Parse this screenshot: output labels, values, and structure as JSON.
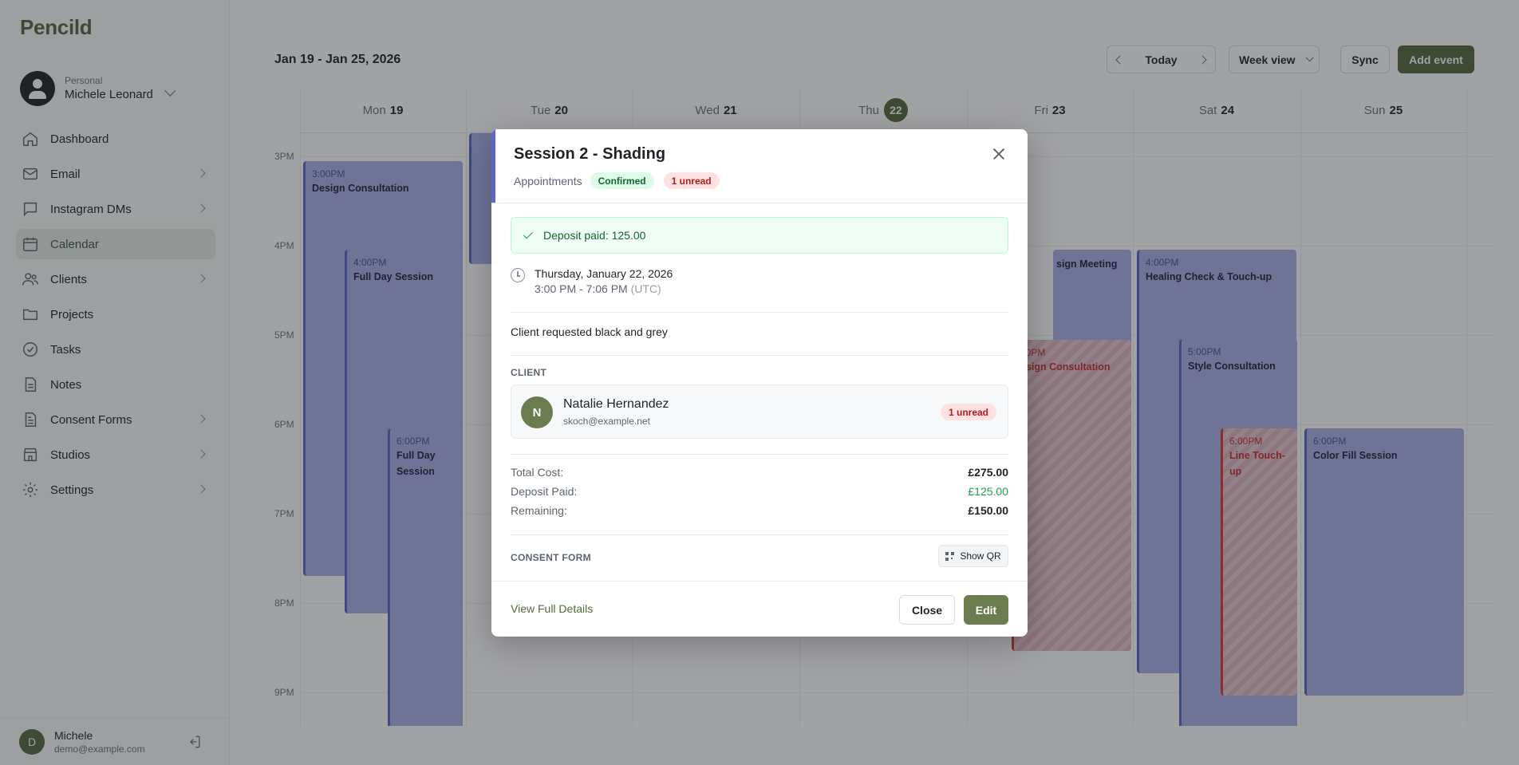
{
  "app": {
    "name": "Pencild"
  },
  "account": {
    "type": "Personal",
    "name": "Michele Leonard"
  },
  "nav": {
    "items": [
      {
        "label": "Dashboard"
      },
      {
        "label": "Email"
      },
      {
        "label": "Instagram DMs"
      },
      {
        "label": "Calendar"
      },
      {
        "label": "Clients"
      },
      {
        "label": "Projects"
      },
      {
        "label": "Tasks"
      },
      {
        "label": "Notes"
      },
      {
        "label": "Consent Forms"
      },
      {
        "label": "Studios"
      },
      {
        "label": "Settings"
      }
    ]
  },
  "user": {
    "initial": "D",
    "name": "Michele",
    "email": "demo@example.com"
  },
  "toolbar": {
    "range": "Jan 19 - Jan 25, 2026",
    "today_label": "Today",
    "view_label": "Week view",
    "sync_label": "Sync",
    "add_label": "Add event"
  },
  "calendar": {
    "days": [
      {
        "name": "Mon",
        "num": "19"
      },
      {
        "name": "Tue",
        "num": "20"
      },
      {
        "name": "Wed",
        "num": "21"
      },
      {
        "name": "Thu",
        "num": "22"
      },
      {
        "name": "Fri",
        "num": "23"
      },
      {
        "name": "Sat",
        "num": "24"
      },
      {
        "name": "Sun",
        "num": "25"
      }
    ],
    "hours": [
      "3PM",
      "4PM",
      "5PM",
      "6PM",
      "7PM",
      "8PM",
      "9PM"
    ],
    "events": [
      {
        "time": "3:00PM",
        "title": "Design Consultation"
      },
      {
        "time": "4:00PM",
        "title": "Full Day Session"
      },
      {
        "time": "6:00PM",
        "title": "Full Day Session"
      },
      {
        "time": "",
        "title": "sign Meeting"
      },
      {
        "time": "00PM",
        "title": "esign Consultation"
      },
      {
        "time": "4:00PM",
        "title": "Healing Check & Touch-up"
      },
      {
        "time": "5:00PM",
        "title": "Style Consultation"
      },
      {
        "time": "6:00PM",
        "title": "Line Touch-up"
      },
      {
        "time": "6:00PM",
        "title": "Color Fill Session"
      }
    ]
  },
  "modal": {
    "title": "Session 2 - Shading",
    "category": "Appointments",
    "status": "Confirmed",
    "unread": "1 unread",
    "deposit_notice": "Deposit paid: 125.00",
    "date": "Thursday, January 22, 2026",
    "time": "3:00 PM - 7:06 PM",
    "timezone": "(UTC)",
    "notes": "Client requested black and grey",
    "client_label": "CLIENT",
    "client": {
      "initial": "N",
      "name": "Natalie Hernandez",
      "email": "skoch@example.net",
      "unread": "1 unread"
    },
    "costs": {
      "total_label": "Total Cost:",
      "total": "£275.00",
      "deposit_label": "Deposit Paid:",
      "deposit": "£125.00",
      "remaining_label": "Remaining:",
      "remaining": "£150.00"
    },
    "consent_label": "CONSENT FORM",
    "qr_label": "Show QR",
    "view_details": "View Full Details",
    "close_label": "Close",
    "edit_label": "Edit"
  },
  "colors": {
    "brand": "#56683f",
    "event": "#a9b0e8",
    "event_border": "#5b66c9",
    "alert": "#d83a3a"
  }
}
